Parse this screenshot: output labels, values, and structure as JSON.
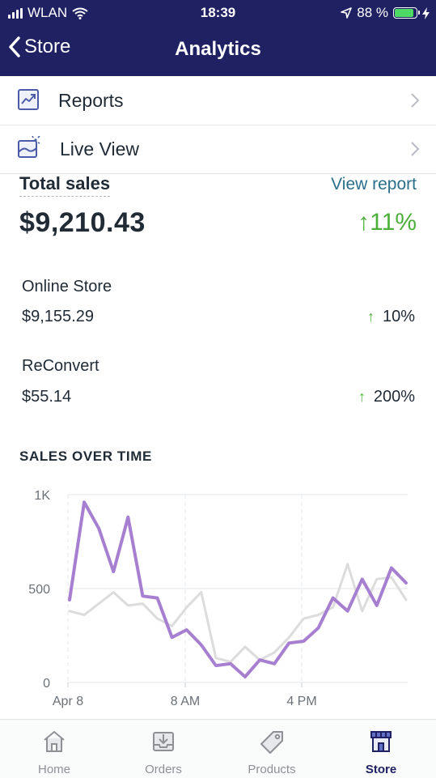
{
  "status": {
    "carrier": "WLAN",
    "time": "18:39",
    "battery": "88 %"
  },
  "nav": {
    "back_label": "Store",
    "title": "Analytics"
  },
  "menu": [
    {
      "label": "Reports",
      "icon": "reports-icon"
    },
    {
      "label": "Live View",
      "icon": "live-view-icon"
    }
  ],
  "total": {
    "label": "Total sales",
    "view_report": "View report",
    "value": "$9,210.43",
    "change": "11%"
  },
  "sources": [
    {
      "name": "Online Store",
      "value": "$9,155.29",
      "change": "10%"
    },
    {
      "name": "ReConvert",
      "value": "$55.14",
      "change": "200%"
    }
  ],
  "section_title": "SALES OVER TIME",
  "chart_data": {
    "type": "line",
    "title": "SALES OVER TIME",
    "x_ticks": [
      "Apr 8",
      "8 AM",
      "4 PM"
    ],
    "y_ticks": [
      "1K",
      "500",
      "0"
    ],
    "ylim": [
      0,
      1000
    ],
    "grid": true,
    "series": [
      {
        "color": "#a77fd0",
        "values": [
          440,
          960,
          820,
          590,
          880,
          460,
          450,
          240,
          280,
          200,
          90,
          100,
          30,
          120,
          100,
          210,
          220,
          290,
          450,
          380,
          550,
          410,
          610,
          530
        ]
      },
      {
        "color": "#dcdcdc",
        "values": [
          380,
          360,
          420,
          480,
          410,
          420,
          340,
          300,
          400,
          480,
          130,
          110,
          190,
          120,
          160,
          240,
          340,
          360,
          400,
          630,
          380,
          550,
          560,
          440
        ]
      }
    ]
  },
  "tabs": [
    {
      "label": "Home",
      "icon": "home-icon",
      "active": false
    },
    {
      "label": "Orders",
      "icon": "orders-icon",
      "active": false
    },
    {
      "label": "Products",
      "icon": "products-icon",
      "active": false
    },
    {
      "label": "Store",
      "icon": "store-icon",
      "active": true
    }
  ],
  "colors": {
    "header": "#1f2163",
    "accent_green": "#4caf3a",
    "link": "#2a6f8a"
  }
}
